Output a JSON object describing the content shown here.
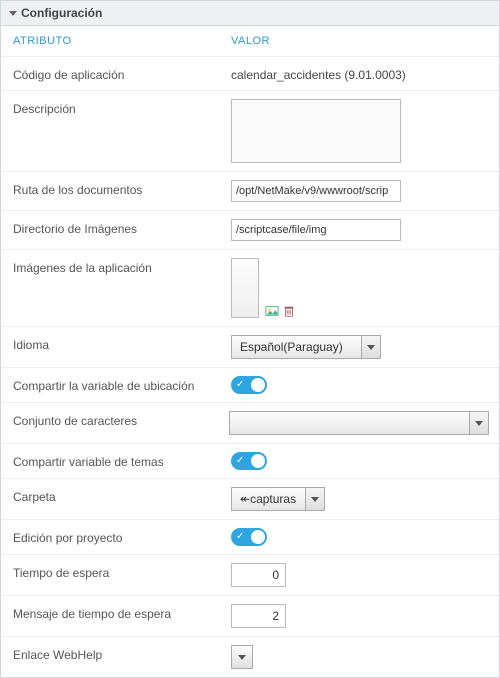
{
  "panel": {
    "title": "Configuración"
  },
  "columns": {
    "attribute": "ATRIBUTO",
    "value": "VALOR"
  },
  "rows": {
    "app_code": {
      "label": "Código de aplicación",
      "value": "calendar_accidentes (9.01.0003)"
    },
    "description": {
      "label": "Descripción",
      "value": ""
    },
    "doc_path": {
      "label": "Ruta de los documentos",
      "value": "/opt/NetMake/v9/wwwroot/scrip"
    },
    "img_dir": {
      "label": "Directorio de Imágenes",
      "value": "/scriptcase/file/img"
    },
    "app_images": {
      "label": "Imágenes de la aplicación"
    },
    "language": {
      "label": "Idioma",
      "value": "Español(Paraguay)"
    },
    "share_loc": {
      "label": "Compartir la variable de ubicación",
      "on": true
    },
    "charset": {
      "label": "Conjunto de caracteres",
      "value": ""
    },
    "share_theme": {
      "label": "Compartir variable de temas",
      "on": true
    },
    "folder": {
      "label": "Carpeta",
      "value": "capturas",
      "icon": "↞"
    },
    "proj_edit": {
      "label": "Edición por proyecto",
      "on": true
    },
    "timeout": {
      "label": "Tiempo de espera",
      "value": "0"
    },
    "timeout_msg": {
      "label": "Mensaje de tiempo de espera",
      "value": "2"
    },
    "webhelp": {
      "label": "Enlace WebHelp",
      "value": ""
    }
  }
}
